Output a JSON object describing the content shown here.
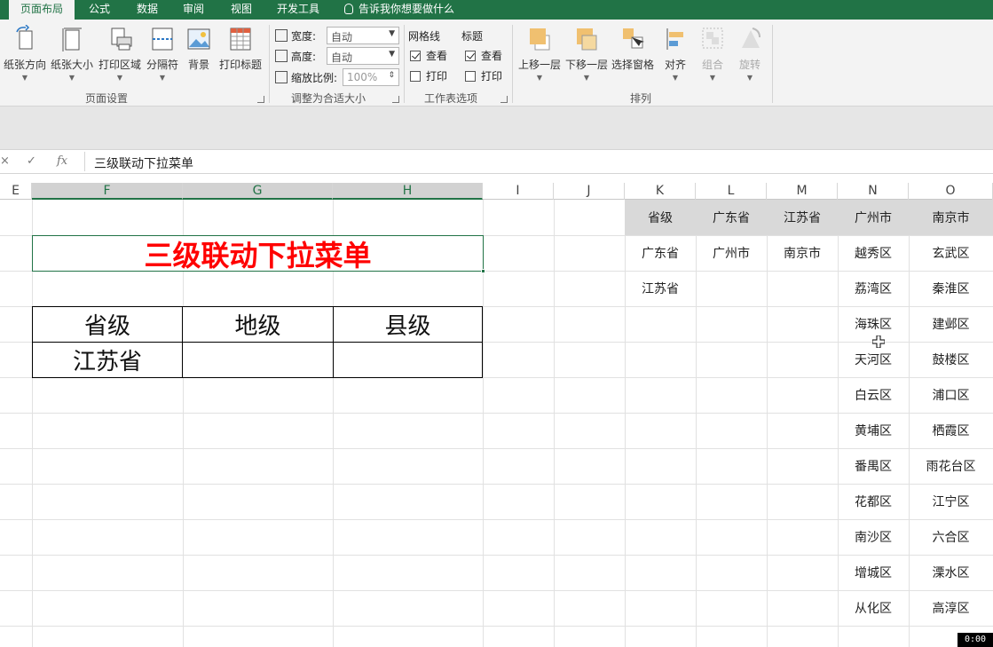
{
  "ribbon_tabs": [
    "页面布局",
    "公式",
    "数据",
    "审阅",
    "视图",
    "开发工具"
  ],
  "tell_me": "告诉我你想要做什么",
  "page_setup": {
    "buttons": [
      "纸张方向",
      "纸张大小",
      "打印区域",
      "分隔符",
      "背景",
      "打印标题"
    ],
    "group_label": "页面设置"
  },
  "scale_to_fit": {
    "width_label": "宽度:",
    "width_value": "自动",
    "height_label": "高度:",
    "height_value": "自动",
    "scale_label": "缩放比例:",
    "scale_value": "100%",
    "group_label": "调整为合适大小"
  },
  "sheet_options": {
    "gridlines_head": "网格线",
    "headings_head": "标题",
    "view": "查看",
    "print": "打印",
    "gridlines_view_checked": true,
    "headings_view_checked": true,
    "group_label": "工作表选项"
  },
  "arrange": {
    "buttons": [
      "上移一层",
      "下移一层",
      "选择窗格",
      "对齐",
      "组合",
      "旋转"
    ],
    "group_label": "排列"
  },
  "formula_bar": {
    "cancel": "×",
    "enter": "✓",
    "fx": "fx",
    "content": "三级联动下拉菜单"
  },
  "columns": [
    "E",
    "F",
    "G",
    "H",
    "I",
    "J",
    "K",
    "L",
    "M",
    "N",
    "O"
  ],
  "sheet": {
    "title": "三级联动下拉菜单",
    "table_headers": [
      "省级",
      "地级",
      "县级"
    ],
    "table_values": [
      "江苏省",
      "",
      ""
    ],
    "lookup_headers": [
      "省级",
      "广东省",
      "江苏省",
      "广州市",
      "南京市"
    ],
    "K": [
      "广东省",
      "江苏省"
    ],
    "L": [
      "广州市"
    ],
    "M": [
      "南京市"
    ],
    "N": [
      "越秀区",
      "荔湾区",
      "海珠区",
      "天河区",
      "白云区",
      "黄埔区",
      "番禺区",
      "花都区",
      "南沙区",
      "增城区",
      "从化区"
    ],
    "O": [
      "玄武区",
      "秦淮区",
      "建邺区",
      "鼓楼区",
      "浦口区",
      "栖霞区",
      "雨花台区",
      "江宁区",
      "六合区",
      "溧水区",
      "高淳区"
    ]
  },
  "timer": "0:00",
  "colors": {
    "accent": "#217346",
    "title_red": "#ff0000",
    "header_gray": "#d9d9d9"
  }
}
